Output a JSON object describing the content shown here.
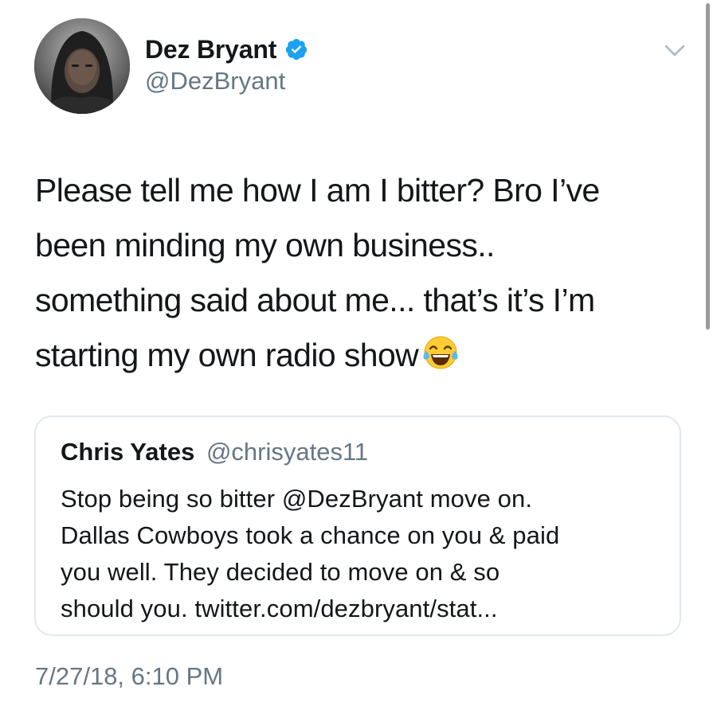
{
  "tweet": {
    "author": {
      "display_name": "Dez Bryant",
      "handle": "@DezBryant",
      "verified": true,
      "avatar_icon": "avatar-photo"
    },
    "text_lines": [
      "Please tell me how I am I bitter? Bro I’ve",
      "been minding my own business..",
      "something said about me... that’s it’s I’m",
      "starting my own radio show"
    ],
    "emoji": "face-with-tears-of-joy",
    "timestamp": "7/27/18, 6:10 PM"
  },
  "quoted_tweet": {
    "author_name": "Chris Yates",
    "author_handle": "@chrisyates11",
    "text_lines": [
      "Stop being so bitter @DezBryant move on.",
      "Dallas Cowboys took a chance on you & paid",
      "you well. They decided to move on & so",
      "should you. twitter.com/dezbryant/stat..."
    ]
  },
  "colors": {
    "primary_text": "#14171a",
    "secondary_text": "#657786",
    "verified_blue": "#1da1f2",
    "card_border": "#e1e8ed"
  }
}
